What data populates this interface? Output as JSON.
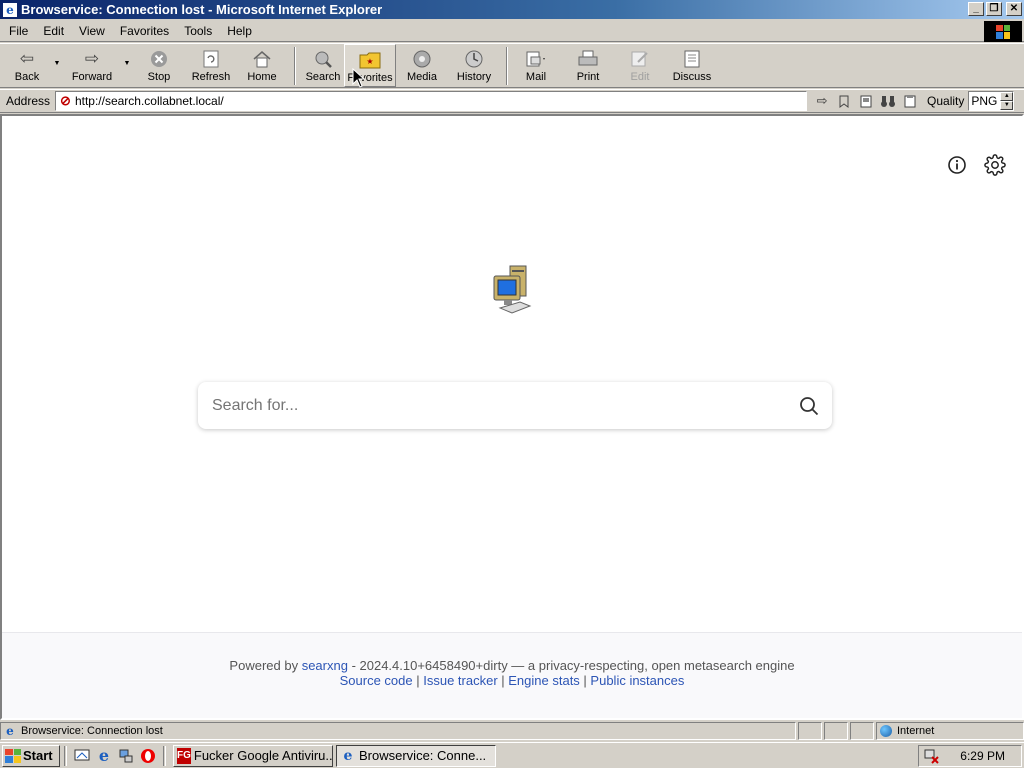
{
  "window": {
    "title": "Browservice: Connection lost - Microsoft Internet Explorer",
    "controls": {
      "minimize": "_",
      "restore": "❐",
      "close": "✕"
    }
  },
  "menu": {
    "items": [
      {
        "label": "File"
      },
      {
        "label": "Edit"
      },
      {
        "label": "View"
      },
      {
        "label": "Favorites"
      },
      {
        "label": "Tools"
      },
      {
        "label": "Help"
      }
    ]
  },
  "toolbar": {
    "back": "Back",
    "forward": "Forward",
    "stop": "Stop",
    "refresh": "Refresh",
    "home": "Home",
    "search": "Search",
    "favorites": "Favorites",
    "media": "Media",
    "history": "History",
    "mail": "Mail",
    "print": "Print",
    "edit": "Edit",
    "discuss": "Discuss"
  },
  "address": {
    "label": "Address",
    "url": "http://search.collabnet.local/",
    "quality_label": "Quality",
    "quality_value": "PNG"
  },
  "page": {
    "search_placeholder": "Search for...",
    "footer": {
      "powered_by": "Powered by",
      "engine_link": "searxng",
      "version_text": " - 2024.4.10+6458490+dirty — a privacy-respecting, open metasearch engine",
      "links": [
        "Source code",
        "Issue tracker",
        "Engine stats",
        "Public instances"
      ],
      "separator": " | "
    }
  },
  "status": {
    "text": "Browservice: Connection lost",
    "zone": "Internet"
  },
  "taskbar": {
    "start": "Start",
    "tasks": [
      {
        "label": "Fucker Google Antiviru...",
        "icon": "FG"
      },
      {
        "label": "Browservice: Conne..."
      }
    ],
    "clock": "6:29 PM"
  },
  "colors": {
    "title_active_start": "#0a246a",
    "title_active_end": "#a6caf0",
    "chrome": "#d4d0c8",
    "link": "#2c55b5"
  }
}
